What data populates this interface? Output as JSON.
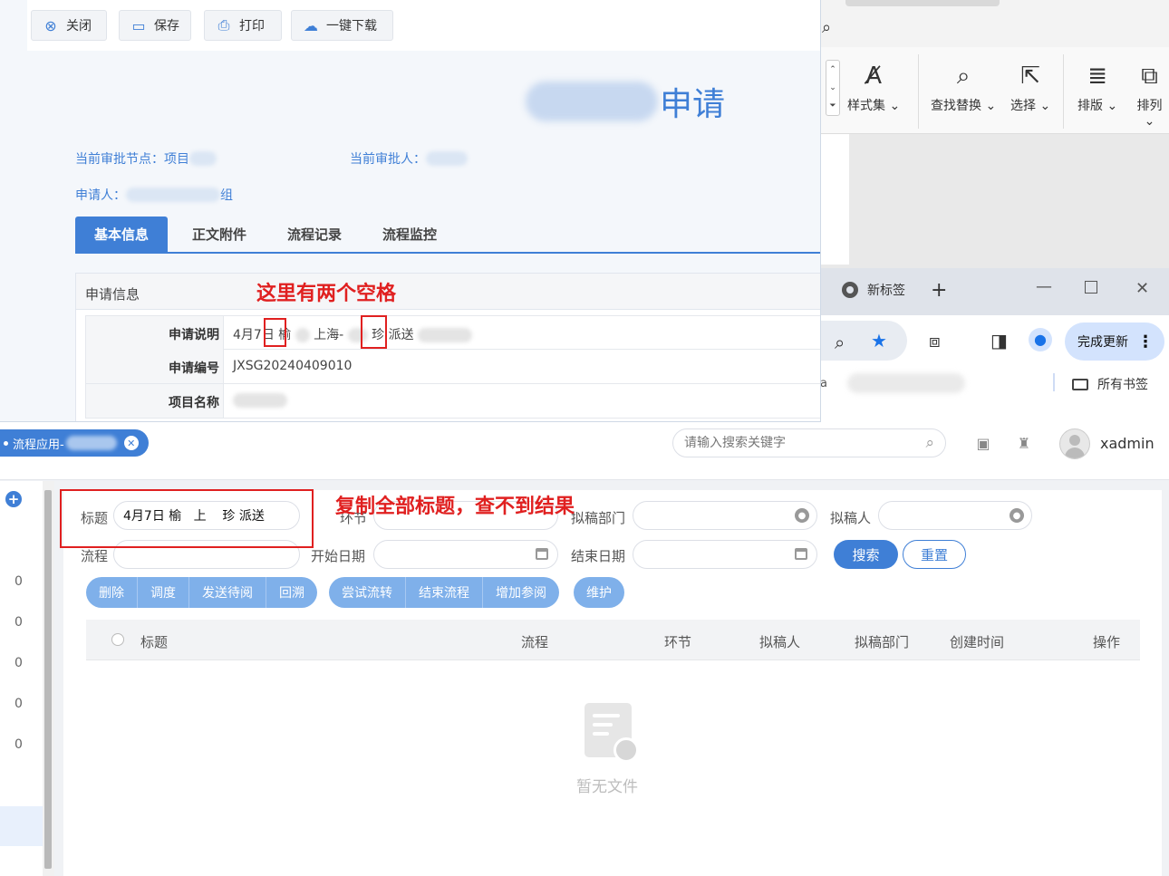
{
  "dialog": {
    "toolbar": {
      "close": "关闭",
      "save": "保存",
      "print": "打印",
      "download": "一键下载"
    },
    "title_suffix": "申请",
    "current_node_label": "当前审批节点：项目",
    "current_approver_label": "当前审批人：",
    "applicant_label": "申请人：",
    "applicant_suffix": "组",
    "tabs": [
      "基本信息",
      "正文附件",
      "流程记录",
      "流程监控"
    ],
    "info_header": "申请信息",
    "fields": [
      {
        "key": "申请说明",
        "value_a": "4月7日 榆",
        "value_b": "上海-",
        "value_c": "珍 派送"
      },
      {
        "key": "申请编号",
        "value": "JXSG20240409010"
      },
      {
        "key": "项目名称",
        "value": ""
      }
    ]
  },
  "annotations": {
    "spaces_note": "这里有两个空格",
    "copy_note": "复制全部标题，查不到结果"
  },
  "word_ribbon": {
    "style_set": "样式集",
    "find_replace": "查找替换",
    "select": "选择",
    "layout": "排版",
    "arrange": "排列"
  },
  "browser": {
    "tab_title": "新标签",
    "update_button": "完成更新",
    "bookmarks_folder": "所有书签",
    "bookmark_fragment": "a"
  },
  "app": {
    "breadcrumb_tag": "流程应用-",
    "search_placeholder": "请输入搜索关键字",
    "username": "xadmin",
    "rail_counts": [
      "0",
      "0",
      "0",
      "0",
      "0"
    ],
    "filters": {
      "title_label": "标题",
      "title_value": "4月7日 榆   上    珍 派送",
      "node_label": "环节",
      "dept_label": "拟稿部门",
      "drafter_label": "拟稿人",
      "flow_label": "流程",
      "start_label": "开始日期",
      "end_label": "结束日期",
      "search_btn": "搜索",
      "reset_btn": "重置"
    },
    "actions_group1": [
      "删除",
      "调度",
      "发送待阅",
      "回溯"
    ],
    "actions_group2": [
      "尝试流转",
      "结束流程",
      "增加参阅"
    ],
    "actions_group3": [
      "维护"
    ],
    "table_columns": [
      "标题",
      "流程",
      "环节",
      "拟稿人",
      "拟稿部门",
      "创建时间",
      "操作"
    ],
    "empty_text": "暂无文件"
  },
  "colors": {
    "accent": "#3f7fd6",
    "annotation": "#e02020"
  }
}
